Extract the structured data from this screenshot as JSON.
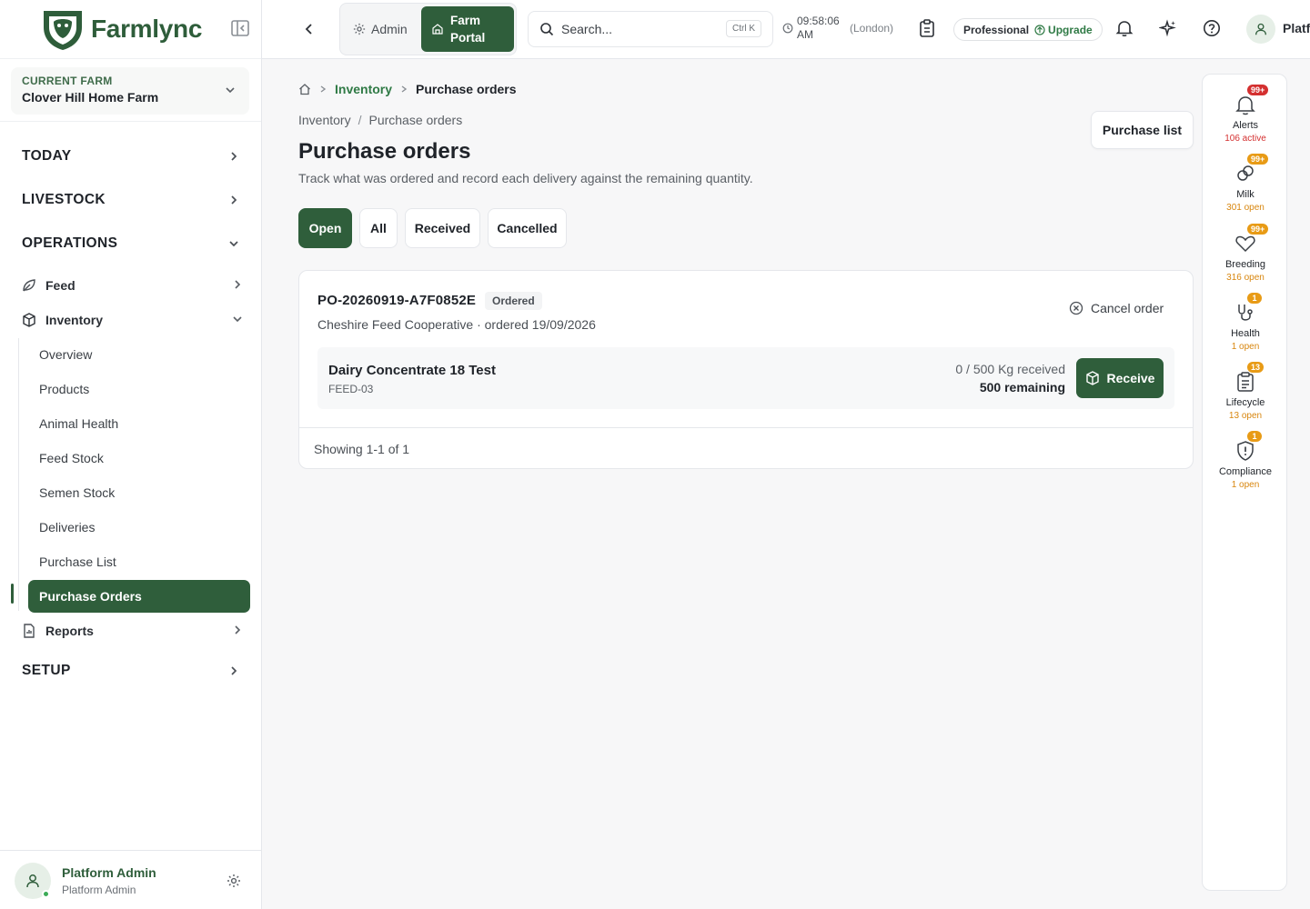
{
  "app": {
    "name": "Farmlync"
  },
  "farm": {
    "label": "CURRENT FARM",
    "name": "Clover Hill Home Farm"
  },
  "nav": {
    "today": "TODAY",
    "livestock": "LIVESTOCK",
    "operations": "OPERATIONS",
    "feed": "Feed",
    "inventory": "Inventory",
    "inventory_items": [
      "Overview",
      "Products",
      "Animal Health",
      "Feed Stock",
      "Semen Stock",
      "Deliveries",
      "Purchase List",
      "Purchase Orders"
    ],
    "reports": "Reports",
    "setup": "SETUP"
  },
  "user": {
    "name": "Platform Admin",
    "role": "Platform Admin",
    "top_name": "Platform Admin"
  },
  "topbar": {
    "admin": "Admin",
    "farm_portal": "Farm Portal",
    "search_placeholder": "Search...",
    "search_shortcut": "Ctrl K",
    "time": "09:58:06 AM",
    "timezone": "(London)",
    "plan": "Professional",
    "upgrade": "Upgrade"
  },
  "breadcrumb": {
    "parent": "Inventory",
    "current": "Purchase orders"
  },
  "header": {
    "sub_crumb_parent": "Inventory",
    "sub_crumb_sep": "/",
    "sub_crumb_current": "Purchase orders",
    "title": "Purchase orders",
    "subtitle": "Track what was ordered and record each delivery against the remaining quantity.",
    "purchase_list_button": "Purchase list"
  },
  "filters": [
    "Open",
    "All",
    "Received",
    "Cancelled"
  ],
  "order": {
    "number": "PO-20260919-A7F0852E",
    "status": "Ordered",
    "meta": "Cheshire Feed Cooperative · ordered 19/09/2026",
    "cancel_label": "Cancel order",
    "line": {
      "name": "Dairy Concentrate 18 Test",
      "code": "FEED-03",
      "received": "0 / 500 Kg received",
      "remaining": "500 remaining",
      "receive_label": "Receive"
    }
  },
  "pagination": {
    "showing": "Showing 1-1 of 1"
  },
  "rail": [
    {
      "label": "Alerts",
      "badge": "99+",
      "count": "106 active",
      "tone": "red",
      "icon": "bell-icon"
    },
    {
      "label": "Milk",
      "badge": "99+",
      "count": "301 open",
      "tone": "amber",
      "icon": "milk-icon"
    },
    {
      "label": "Breeding",
      "badge": "99+",
      "count": "316 open",
      "tone": "amber",
      "icon": "heart-icon"
    },
    {
      "label": "Health",
      "badge": "1",
      "count": "1 open",
      "tone": "amber",
      "icon": "stethoscope-icon"
    },
    {
      "label": "Lifecycle",
      "badge": "13",
      "count": "13 open",
      "tone": "amber",
      "icon": "clipboard-icon"
    },
    {
      "label": "Compliance",
      "badge": "1",
      "count": "1 open",
      "tone": "amber",
      "icon": "shield-icon"
    }
  ],
  "colors": {
    "brand": "#2f5e3b",
    "alert": "#d43030",
    "warn": "#e89b16"
  }
}
